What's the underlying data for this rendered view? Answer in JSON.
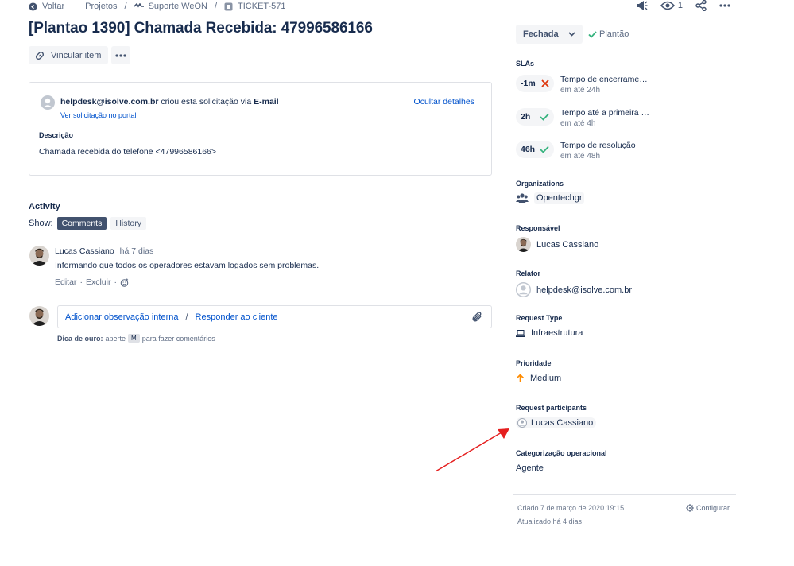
{
  "breadcrumb": {
    "back_label": "Voltar",
    "projects": "Projetos",
    "sep1": "/",
    "project": "Suporte WeON",
    "sep2": "/",
    "ticket": "TICKET-571"
  },
  "top_actions": {
    "watchers_count": "1"
  },
  "ticket": {
    "title": "[Plantao 1390] Chamada Recebida: 47996586166"
  },
  "toolbar": {
    "link_item_label": "Vincular item"
  },
  "request_card": {
    "requester_email": "helpdesk@isolve.com.br",
    "created_text": "criou esta solicitação via",
    "channel": "E-mail",
    "portal_link": "Ver solicitação no portal",
    "hide_details": "Ocultar detalhes",
    "description_label": "Descrição",
    "description_text": "Chamada recebida do telefone  <47996586166>"
  },
  "activity": {
    "title": "Activity",
    "show_label": "Show:",
    "tabs": [
      {
        "label": "Comments",
        "active": true
      },
      {
        "label": "History",
        "active": false
      }
    ],
    "comments": [
      {
        "author": "Lucas Cassiano",
        "time": "há 7 dias",
        "body": "Informando que todos os operadores estavam logados sem problemas.",
        "edit": "Editar",
        "dot1": "·",
        "delete": "Excluir",
        "dot2": "·"
      }
    ],
    "reply": {
      "internal_note": "Adicionar observação interna",
      "slash": "/",
      "reply_customer": "Responder ao cliente"
    },
    "tip": {
      "label": "Dica de ouro:",
      "text1": "aperte",
      "key": "M",
      "text2": "para fazer comentários"
    }
  },
  "status": {
    "current": "Fechada",
    "resolution": "Plantão",
    "resolution_color": "#36b37e"
  },
  "slas": {
    "title": "SLAs",
    "items": [
      {
        "time": "-1m",
        "state": "breached",
        "name": "Tempo de encerrame…",
        "sub": "em até 24h"
      },
      {
        "time": "2h",
        "state": "met",
        "name": "Tempo até a primeira …",
        "sub": "em até 4h"
      },
      {
        "time": "46h",
        "state": "met",
        "name": "Tempo de resolução",
        "sub": "em até 48h"
      }
    ],
    "breached_color": "#de350b",
    "met_color": "#36b37e"
  },
  "fields": {
    "organizations": {
      "label": "Organizations",
      "value": "Opentechgr"
    },
    "assignee": {
      "label": "Responsável",
      "value": "Lucas Cassiano"
    },
    "reporter": {
      "label": "Relator",
      "value": "helpdesk@isolve.com.br"
    },
    "request_type": {
      "label": "Request Type",
      "value": "Infraestrutura"
    },
    "priority": {
      "label": "Prioridade",
      "value": "Medium",
      "color": "#ff8b00"
    },
    "participants": {
      "label": "Request participants",
      "value": "Lucas Cassiano"
    },
    "categorization": {
      "label": "Categorização operacional",
      "value": "Agente"
    }
  },
  "footer": {
    "created": "Criado 7 de março de 2020 19:15",
    "updated": "Atualizado há 4 dias",
    "configure": "Configurar"
  },
  "annotation": {
    "arrow_color": "#e51f1f"
  }
}
